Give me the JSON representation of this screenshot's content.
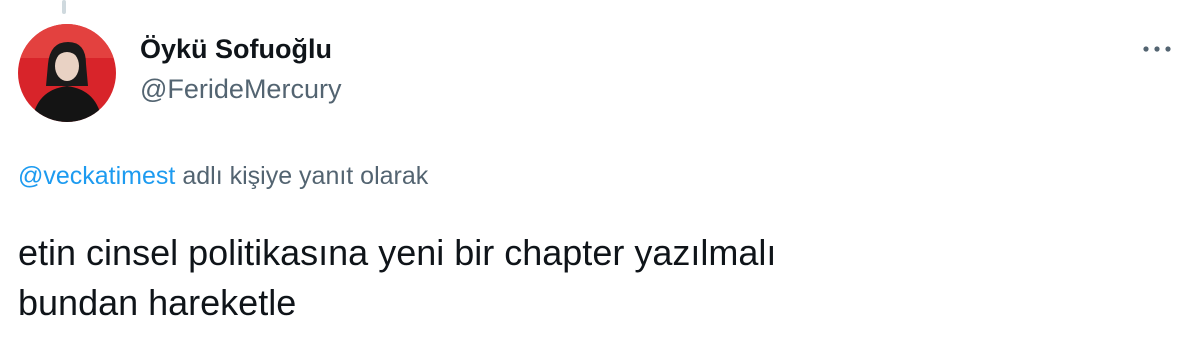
{
  "author": {
    "display_name": "Öykü Sofuoğlu",
    "handle": "@FerideMercury",
    "avatar_icon": "profile-photo-icon"
  },
  "menu": {
    "icon": "more-dots-icon"
  },
  "reply": {
    "mention": "@veckatimest",
    "suffix": "adlı kişiye yanıt olarak"
  },
  "tweet": {
    "lines": [
      "etin cinsel politikasına yeni bir chapter yazılmalı",
      "bundan hareketle"
    ]
  },
  "colors": {
    "link": "#1d9bf0",
    "secondary": "#536471",
    "primary": "#0f1419",
    "avatar_bg": "#d8242a"
  }
}
